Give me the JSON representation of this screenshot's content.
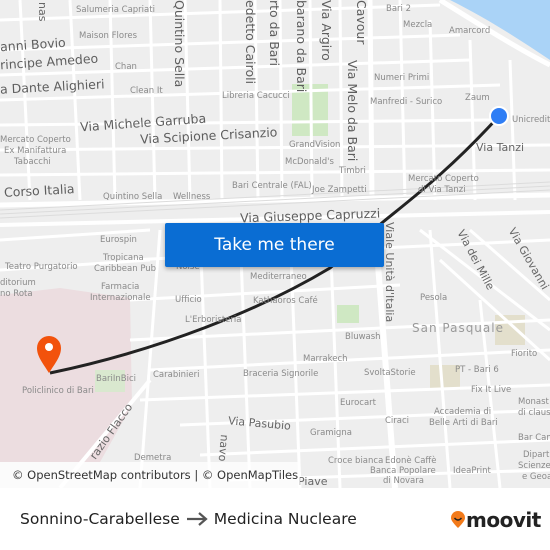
{
  "map": {
    "colors": {
      "background": "#eeeeee",
      "road": "#ffffff",
      "water": "#aad3f7",
      "park": "#cfe8c3",
      "hospital": "#ecdde0",
      "route": "#222222",
      "origin": "#2f7ef5",
      "destination": "#f2520c",
      "button": "#0a6dd3"
    },
    "labels": {
      "nas": "nas",
      "salumeria": "Salumeria Capriati",
      "maison": "Maison Flores",
      "bovio": "anni Bovio",
      "amedeo": "rincipe Amedeo",
      "dante": "a Dante Alighieri",
      "chan": "Chan",
      "cleanit": "Clean It",
      "quintino_v": "Quintino Sella",
      "cairoli": "edetto Cairoli",
      "rtobari": "rto da Bari",
      "baranobari": "barano da Bari",
      "argiro": "Via Argiro",
      "cavour": "Cavour",
      "melo": "Via Melo da Bari",
      "bari2": "Bari 2",
      "mezcla": "Mezcla",
      "amarcord": "Amarcord",
      "numeri": "Numeri Primi",
      "manfredi": "Manfredi - Surico",
      "zaum": "Zaum",
      "libreria": "Libreria Cacucci",
      "garruba": "Via Michele Garruba",
      "crisanzio": "Via Scipione Crisanzio",
      "mercato1": "Mercato Coperto",
      "mercato2": "Ex Manifattura",
      "mercato3": "Tabacchi",
      "grandvision": "GrandVision",
      "mcdonalds": "McDonald's",
      "timbri": "Timbri",
      "unicredit": "Unicredit",
      "tanzi": "Via Tanzi",
      "corso": "Corso Italia",
      "quintino_h": "Quintino Sella",
      "wellness": "Wellness",
      "baricentrale": "Bari Centrale (FAL)",
      "zampetti": "Joe Zampetti",
      "mercatotanzi1": "Mercato Coperto",
      "mercatotanzi2": "di Via Tanzi",
      "capruzzi": "Via Giuseppe Capruzzi",
      "eurospin": "Eurospin",
      "tropicana1": "Tropicana",
      "tropicana2": "Caribbean Pub",
      "purgatorio": "Teatro Purgatorio",
      "auditorium1": "ditorium",
      "auditorium2": "no Rota",
      "farmacia1": "Farmacia",
      "farmacia2": "Internazionale",
      "ufficio": "Ufficio",
      "erboristeria": "L'Erboristeria",
      "noise": "Noise",
      "mediterraneo": "Mediterraneo",
      "kathaoros": "Kathaoros Café",
      "mille": "Via dei Mille",
      "giovanni": "Via Giovanni",
      "unita": "Viale Unità d'Italia",
      "pesola": "Pesola",
      "sanpasquale": "San Pasquale",
      "bluwash": "Bluwash",
      "marrakech": "Marrakech",
      "braceria": "Braceria Signorile",
      "svolta": "SvoltaStorie",
      "fiorito": "Fiorito",
      "ptbari": "PT - Bari 6",
      "fixit": "Fix It Live",
      "policlinico": "Policlinico di Bari",
      "bariinbici": "BariInBici",
      "carabinieri": "Carabinieri",
      "eurocart": "Eurocart",
      "ciraci": "Ciraci",
      "accademia1": "Accademia di",
      "accademia2": "Belle Arti di Bari",
      "monastero1": "Monast",
      "monastero2": "di claus",
      "pasubio": "Via Pasubio",
      "gramigna": "Gramigna",
      "barcam": "Bar Cam",
      "dip1": "Diparti",
      "dip2": "Scienze",
      "dip3": "e Geoa",
      "flacco": "razio Flacco",
      "navo": "navo",
      "demetra": "Demetra",
      "croce": "Croce bianca",
      "edone": "Edonè Caffè",
      "ideaprint": "IdeaPrint",
      "banca1": "Banca Popolare",
      "banca2": "di Novara",
      "piave": "Piave"
    },
    "cta_button": "Take me there",
    "attribution": "© OpenStreetMap contributors | © OpenMapTiles"
  },
  "footer": {
    "origin": "Sonnino-Carabellese",
    "arrow_icon": "arrow-right-icon",
    "destination": "Medicina Nucleare",
    "logo": "moovit"
  }
}
